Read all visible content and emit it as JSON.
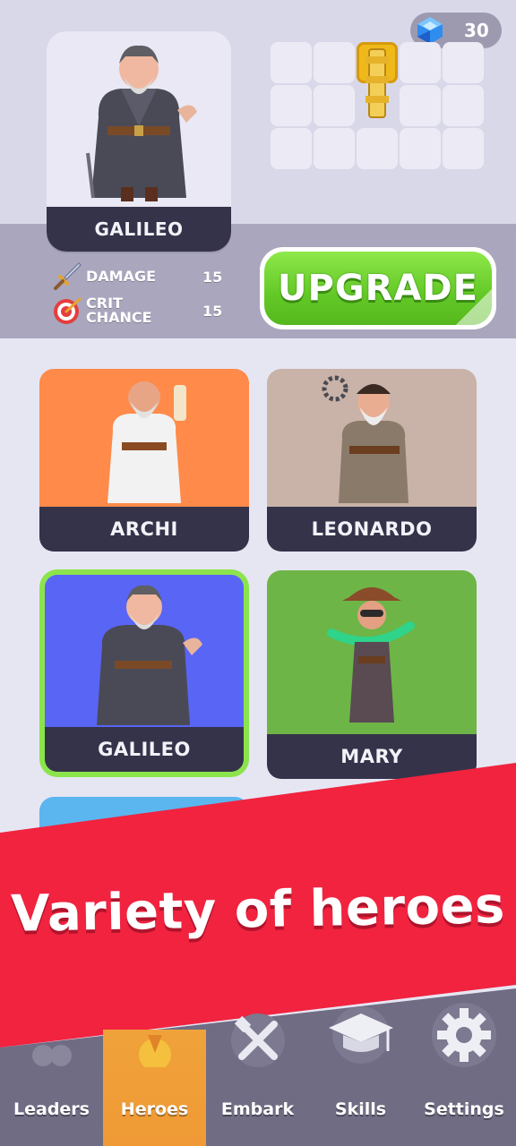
{
  "currency": {
    "gems": "30",
    "icon": "gem-icon",
    "color": "#2f8df0"
  },
  "selected_hero": {
    "name": "GALILEO"
  },
  "inventory": {
    "filled_slot": "golden-pipe-item"
  },
  "stats": [
    {
      "label": "DAMAGE",
      "value": "15",
      "icon": "sword-icon"
    },
    {
      "label": "CRIT\nCHANCE",
      "value": "15",
      "icon": "target-icon"
    }
  ],
  "upgrade_label": "UPGRADE",
  "roster": [
    {
      "name": "ARCHI",
      "bg": "#ff8a4a"
    },
    {
      "name": "LEONARDO",
      "bg": "#c9b2a8"
    },
    {
      "name": "GALILEO",
      "bg": "#5965f4",
      "selected": true
    },
    {
      "name": "MARY",
      "bg": "#6db546"
    }
  ],
  "banner": {
    "text": "Variety of heroes",
    "color": "#f1233f"
  },
  "nav": [
    {
      "label": "Leaders",
      "icon": "leaders-icon"
    },
    {
      "label": "Heroes",
      "icon": "heroes-icon",
      "active": true
    },
    {
      "label": "Embark",
      "icon": "crossed-tools-icon"
    },
    {
      "label": "Skills",
      "icon": "graduation-cap-icon"
    },
    {
      "label": "Settings",
      "icon": "gear-icon"
    }
  ],
  "colors": {
    "accent_green": "#6fd12f",
    "dark_bar": "#35334a",
    "nav_bg": "#6f6c84",
    "nav_active": "#ef9a36"
  }
}
